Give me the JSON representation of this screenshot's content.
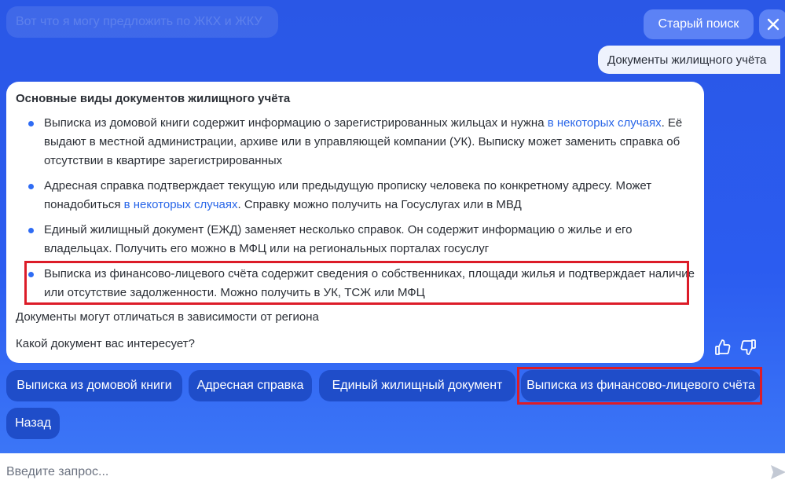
{
  "header": {
    "search_hint": "Вот что я могу предложить по ЖКХ и ЖКУ",
    "old_search_label": "Старый поиск",
    "close_icon": "close-icon"
  },
  "chat": {
    "user_message": "Документы жилищного учёта",
    "answer": {
      "title": "Основные виды документов жилищного учёта",
      "bullets": [
        {
          "before": "Выписка из домовой книги содержит информацию о зарегистрированных жильцах и нужна ",
          "link": "в некоторых случаях",
          "after": ". Её выдают в местной администрации, архиве или в управляющей компании (УК). Выписку может заменить справка об отсутствии в квартире зарегистрированных"
        },
        {
          "before": "Адресная справка подтверждает текущую или предыдущую прописку человека по конкретному адресу. Может понадобиться ",
          "link": "в некоторых случаях",
          "after": ". Справку можно получить на Госуслугах или в МВД"
        },
        {
          "text": "Единый жилищный документ (ЕЖД) заменяет несколько справок. Он содержит информацию о жилье и его владельцах. Получить его можно в МФЦ или на региональных порталах госуслуг"
        },
        {
          "text": "Выписка из финансово-лицевого счёта содержит сведения о собственниках, площади жилья и подтверждает наличие или отсутствие задолженности. Можно получить в УК, ТСЖ или МФЦ"
        }
      ],
      "note": "Документы могут отличаться в зависимости от региона",
      "question": "Какой документ вас интересует?"
    },
    "feedback": {
      "like_icon": "thumbs-up-icon",
      "dislike_icon": "thumbs-down-icon"
    },
    "chips": [
      {
        "label": "Выписка из домовой книги"
      },
      {
        "label": "Адресная справка"
      },
      {
        "label": "Единый жилищный документ"
      },
      {
        "label": "Выписка из финансово-лицевого счёта"
      },
      {
        "label": "Назад"
      }
    ]
  },
  "input": {
    "placeholder": "Введите запрос...",
    "value": "",
    "send_icon": "send-icon"
  },
  "colors": {
    "background": "#2b5cf0",
    "chip": "#1f4dc9",
    "highlight": "#dc1c28",
    "link": "#2966e8"
  }
}
